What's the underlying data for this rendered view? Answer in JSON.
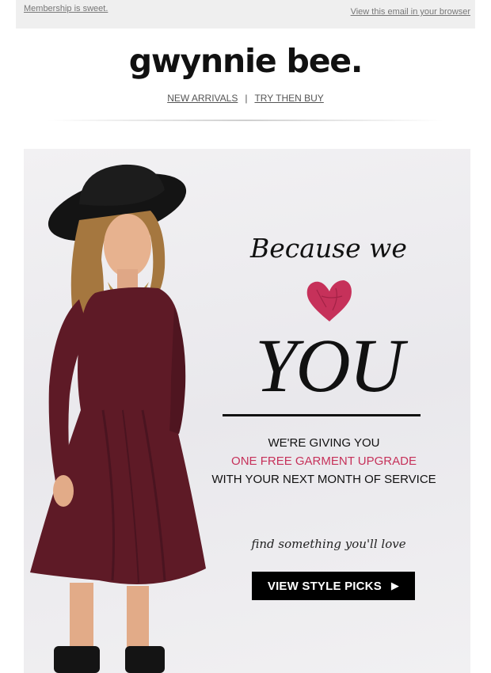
{
  "preheader": {
    "left_link": "Membership is sweet.",
    "right_link": "View this email in your browser"
  },
  "header": {
    "logo_text": "gwynnie bee.",
    "nav": {
      "items": [
        "NEW ARRIVALS",
        "TRY THEN BUY"
      ],
      "separator": "|"
    }
  },
  "hero": {
    "headline_top": "Because we",
    "headline_main": "YOU",
    "heart_icon": "heart-icon",
    "offer_line_1": "WE'RE GIVING YOU",
    "offer_line_2": "ONE FREE GARMENT UPGRADE",
    "offer_line_3": "WITH YOUR NEXT MONTH OF SERVICE",
    "tagline": "find something you'll love",
    "cta_label": "VIEW STYLE PICKS",
    "cta_icon": "play-arrow-icon"
  },
  "colors": {
    "accent": "#c6315a",
    "dress": "#5e1a26",
    "cta_bg": "#000000",
    "preheader_bg": "#efefef"
  }
}
